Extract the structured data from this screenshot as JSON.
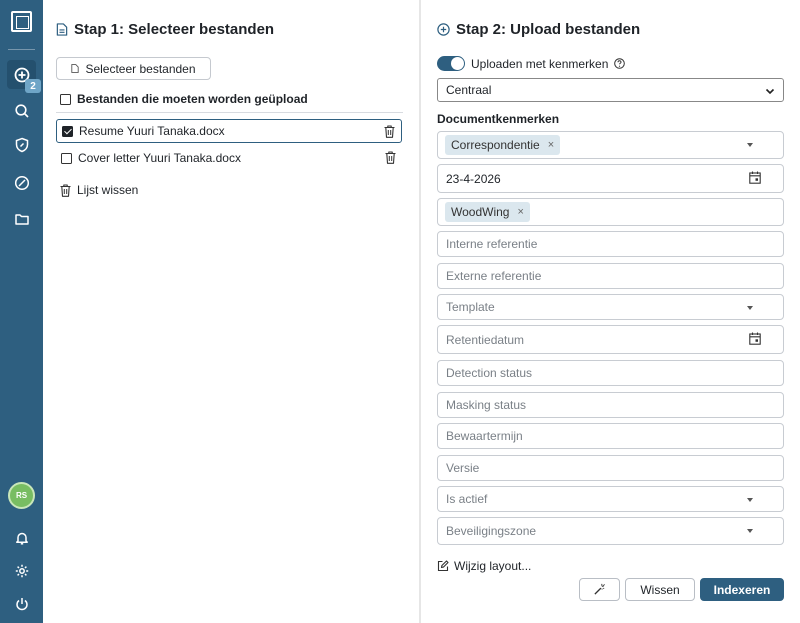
{
  "sidebar": {
    "badge_count": "2",
    "avatar_initials": "RS",
    "accent_color": "#2e5f80"
  },
  "step1": {
    "title": "Stap 1: Selecteer bestanden",
    "select_button": "Selecteer bestanden",
    "files_header": "Bestanden die moeten worden geüpload",
    "files": [
      {
        "name": "Resume Yuuri Tanaka.docx",
        "checked": true
      },
      {
        "name": "Cover letter Yuuri Tanaka.docx",
        "checked": false
      }
    ],
    "clear_list": "Lijst wissen"
  },
  "step2": {
    "title": "Stap 2: Upload bestanden",
    "toggle_label": "Uploaden met kenmerken",
    "location_select": "Centraal",
    "section_label": "Documentkenmerken",
    "fields": {
      "correspondentie_chip": "Correspondentie",
      "date_value": "23-4-2026",
      "woodwing_chip": "WoodWing",
      "interne_referentie": "Interne referentie",
      "externe_referentie": "Externe referentie",
      "template": "Template",
      "retentiedatum": "Retentiedatum",
      "detection_status": "Detection status",
      "masking_status": "Masking status",
      "bewaartermijn": "Bewaartermijn",
      "versie": "Versie",
      "is_actief": "Is actief",
      "beveiligingszone": "Beveiligingszone"
    },
    "change_layout": "Wijzig layout...",
    "clear_button": "Wissen",
    "index_button": "Indexeren"
  }
}
